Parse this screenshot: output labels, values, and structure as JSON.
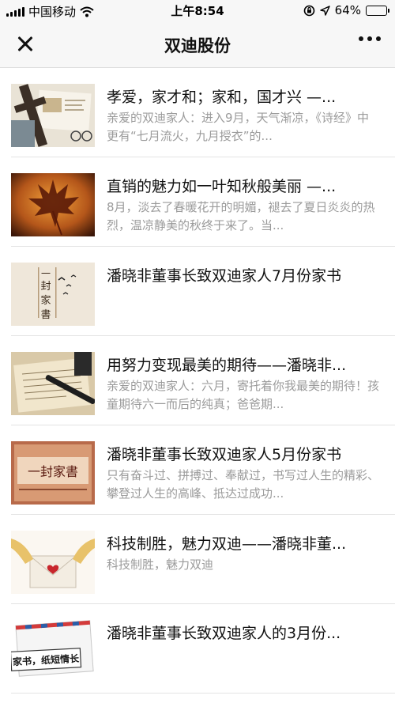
{
  "status_bar": {
    "carrier": "中国移动",
    "time": "上午8:54",
    "battery_percent": "64%",
    "battery_level": 0.64
  },
  "header": {
    "title": "双迪股份"
  },
  "articles": [
    {
      "title": "孝爱，家才和；家和，国才兴 —...",
      "desc": "亲爱的双迪家人：进入9月，天气渐凉，《诗经》中更有“七月流火，九月授衣”的..."
    },
    {
      "title": "直销的魅力如一叶知秋般美丽 —...",
      "desc": "8月，淡去了春暖花开的明媚，褪去了夏日炎炎的热烈，温凉静美的秋终于来了。当..."
    },
    {
      "title": "潘晓非董事长致双迪家人7月份家书",
      "desc": "",
      "thumb_text": [
        "一",
        "封",
        "家",
        "書"
      ]
    },
    {
      "title": "用努力变现最美的期待——潘晓非...",
      "desc": "亲爱的双迪家人：六月，寄托着你我最美的期待！孩童期待六一而后的纯真；爸爸期..."
    },
    {
      "title": "潘晓非董事长致双迪家人5月份家书",
      "desc": "只有奋斗过、拼搏过、奉献过，书写过人生的精彩、攀登过人生的高峰、抵达过成功...",
      "thumb_text": [
        "一封家書"
      ]
    },
    {
      "title": "科技制胜，魅力双迪——潘晓非董...",
      "desc": "科技制胜，魅力双迪"
    },
    {
      "title": "潘晓非董事长致双迪家人的3月份...",
      "desc": "",
      "thumb_text": [
        "家书，纸短情长"
      ]
    }
  ]
}
